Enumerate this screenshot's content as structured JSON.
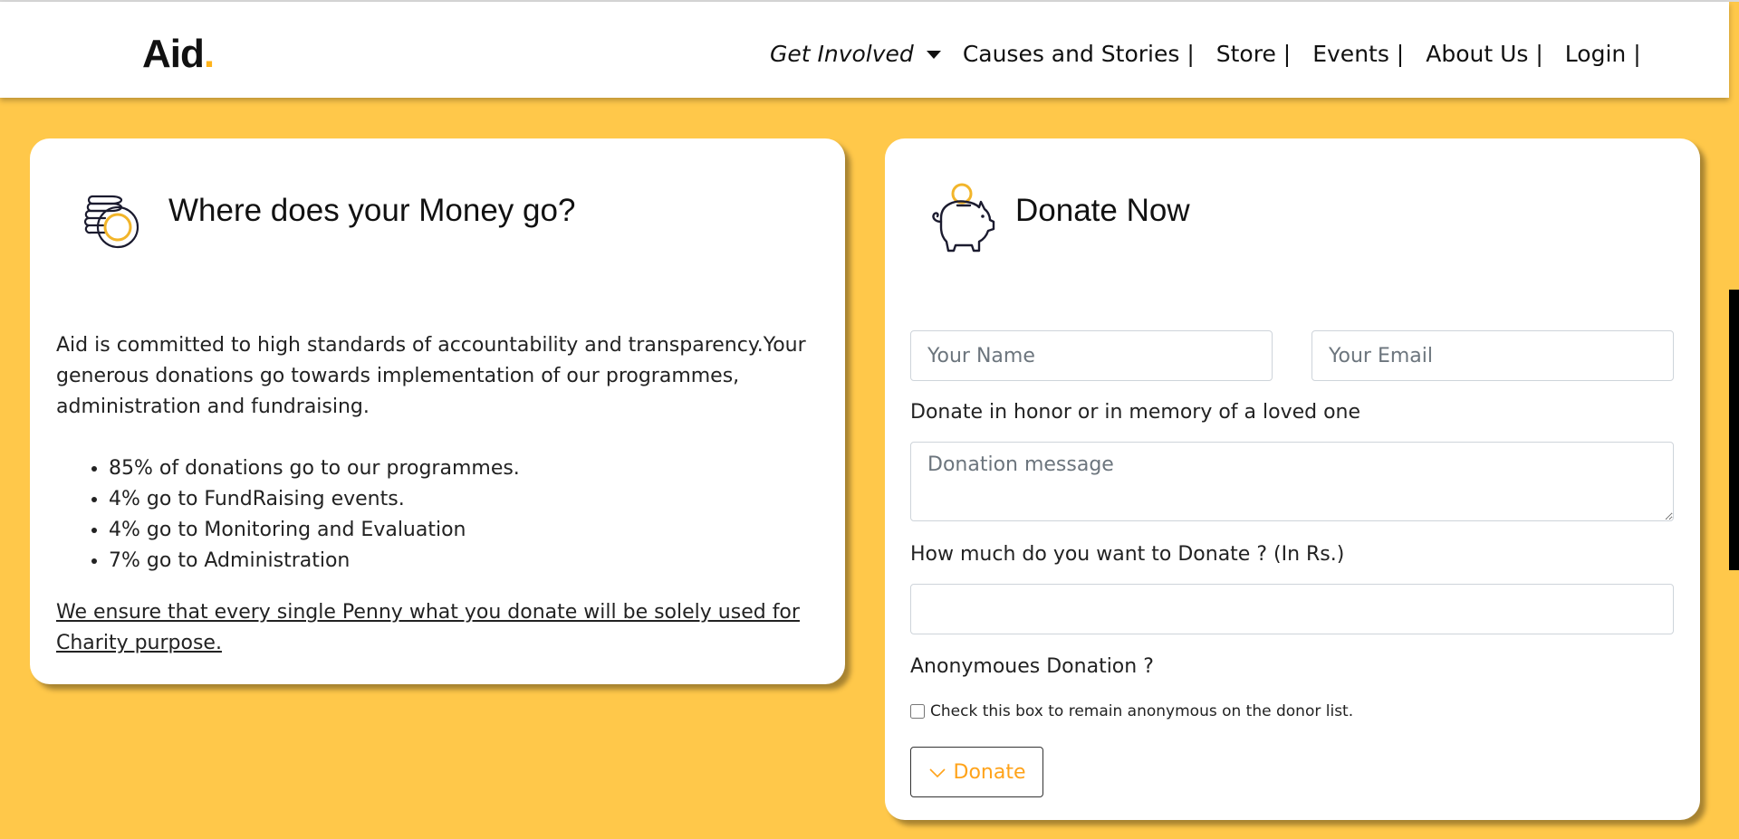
{
  "brand": {
    "name": "Aid",
    "dot": ".",
    "accent": "#ffb31a"
  },
  "nav": {
    "items": [
      {
        "label": "Get Involved",
        "dropdown": true
      },
      {
        "label": "Causes and Stories |"
      },
      {
        "label": "Store |"
      },
      {
        "label": "Events |"
      },
      {
        "label": "About Us |"
      },
      {
        "label": "Login |"
      }
    ]
  },
  "colors": {
    "background": "#ffc84a",
    "accent": "#ffa31a"
  },
  "money_card": {
    "icon": "coins-icon",
    "title": "Where does your Money go?",
    "intro": "Aid is committed to high standards of accountability and transparency.Your generous donations go towards implementation of our programmes, administration and fundraising.",
    "stats": [
      "85% of donations go to our programmes.",
      "4% go to FundRaising events.",
      "4% go to Monitoring and Evaluation",
      "7% go to Administration"
    ],
    "pledge": "We ensure that every single Penny what you donate will be solely used for Charity purpose."
  },
  "donate_card": {
    "icon": "piggy-bank-icon",
    "title": "Donate Now",
    "name_placeholder": "Your Name",
    "email_placeholder": "Your Email",
    "honor_label": "Donate in honor or in memory of a loved one",
    "message_placeholder": "Donation message",
    "amount_label": "How much do you want to Donate ? (In Rs.)",
    "amount_value": "",
    "anon_label": "Anonymoues Donation ?",
    "anon_checkbox_label": "Check this box to remain anonymous on the donor list.",
    "anon_checked": false,
    "button_label": "Donate"
  }
}
